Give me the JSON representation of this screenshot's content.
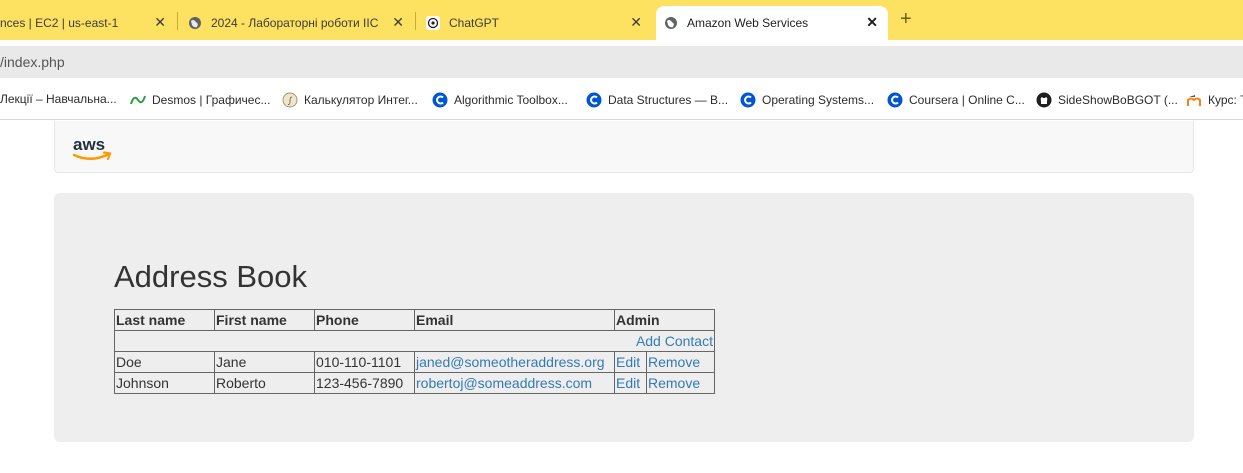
{
  "browser": {
    "tabs": [
      {
        "title": "nces | EC2 | us-east-1",
        "icon": "aws-icon",
        "active": false
      },
      {
        "title": "2024 - Лабораторні роботи ІІС",
        "icon": "globe-icon",
        "active": false
      },
      {
        "title": "ChatGPT",
        "icon": "chatgpt-icon",
        "active": false
      },
      {
        "title": "Amazon Web Services",
        "icon": "globe-icon",
        "active": true
      }
    ],
    "close_glyph": "✕",
    "new_tab_glyph": "+",
    "url": "/index.php",
    "bookmarks": [
      {
        "label": "Лекції – Навчальна...",
        "icon": "bookmark-icon"
      },
      {
        "label": "Desmos | Графичес...",
        "icon": "desmos-icon"
      },
      {
        "label": "Калькулятор Интег...",
        "icon": "calculator-icon"
      },
      {
        "label": "Algorithmic Toolbox...",
        "icon": "coursera-icon"
      },
      {
        "label": "Data Structures — B...",
        "icon": "coursera-icon"
      },
      {
        "label": "Operating Systems...",
        "icon": "coursera-icon"
      },
      {
        "label": "Coursera | Online C...",
        "icon": "coursera-icon"
      },
      {
        "label": "SideShowBoBGOT (...",
        "icon": "github-icon"
      },
      {
        "label": "Курс: Т",
        "icon": "moodle-icon"
      }
    ]
  },
  "page": {
    "logo_text": "aws",
    "heading": "Address Book",
    "columns": [
      "Last name",
      "First name",
      "Phone",
      "Email",
      "Admin"
    ],
    "add_contact_label": "Add Contact",
    "rows": [
      {
        "last": "Doe",
        "first": "Jane",
        "phone": "010-110-1101",
        "email": "janed@someotheraddress.org",
        "edit": "Edit",
        "remove": "Remove"
      },
      {
        "last": "Johnson",
        "first": "Roberto",
        "phone": "123-456-7890",
        "email": "robertoj@someaddress.com",
        "edit": "Edit",
        "remove": "Remove"
      }
    ]
  },
  "colors": {
    "tabstrip": "#fde160",
    "link": "#337ab7",
    "jumbotron": "#eeeeee"
  }
}
